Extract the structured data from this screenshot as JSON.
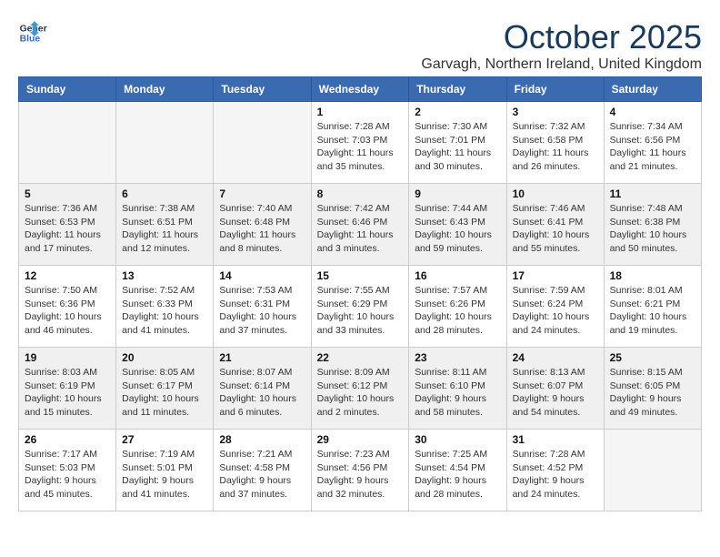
{
  "header": {
    "logo_line1": "General",
    "logo_line2": "Blue",
    "month_title": "October 2025",
    "location": "Garvagh, Northern Ireland, United Kingdom"
  },
  "days_of_week": [
    "Sunday",
    "Monday",
    "Tuesday",
    "Wednesday",
    "Thursday",
    "Friday",
    "Saturday"
  ],
  "weeks": [
    [
      {
        "day": "",
        "detail": ""
      },
      {
        "day": "",
        "detail": ""
      },
      {
        "day": "",
        "detail": ""
      },
      {
        "day": "1",
        "detail": "Sunrise: 7:28 AM\nSunset: 7:03 PM\nDaylight: 11 hours\nand 35 minutes."
      },
      {
        "day": "2",
        "detail": "Sunrise: 7:30 AM\nSunset: 7:01 PM\nDaylight: 11 hours\nand 30 minutes."
      },
      {
        "day": "3",
        "detail": "Sunrise: 7:32 AM\nSunset: 6:58 PM\nDaylight: 11 hours\nand 26 minutes."
      },
      {
        "day": "4",
        "detail": "Sunrise: 7:34 AM\nSunset: 6:56 PM\nDaylight: 11 hours\nand 21 minutes."
      }
    ],
    [
      {
        "day": "5",
        "detail": "Sunrise: 7:36 AM\nSunset: 6:53 PM\nDaylight: 11 hours\nand 17 minutes."
      },
      {
        "day": "6",
        "detail": "Sunrise: 7:38 AM\nSunset: 6:51 PM\nDaylight: 11 hours\nand 12 minutes."
      },
      {
        "day": "7",
        "detail": "Sunrise: 7:40 AM\nSunset: 6:48 PM\nDaylight: 11 hours\nand 8 minutes."
      },
      {
        "day": "8",
        "detail": "Sunrise: 7:42 AM\nSunset: 6:46 PM\nDaylight: 11 hours\nand 3 minutes."
      },
      {
        "day": "9",
        "detail": "Sunrise: 7:44 AM\nSunset: 6:43 PM\nDaylight: 10 hours\nand 59 minutes."
      },
      {
        "day": "10",
        "detail": "Sunrise: 7:46 AM\nSunset: 6:41 PM\nDaylight: 10 hours\nand 55 minutes."
      },
      {
        "day": "11",
        "detail": "Sunrise: 7:48 AM\nSunset: 6:38 PM\nDaylight: 10 hours\nand 50 minutes."
      }
    ],
    [
      {
        "day": "12",
        "detail": "Sunrise: 7:50 AM\nSunset: 6:36 PM\nDaylight: 10 hours\nand 46 minutes."
      },
      {
        "day": "13",
        "detail": "Sunrise: 7:52 AM\nSunset: 6:33 PM\nDaylight: 10 hours\nand 41 minutes."
      },
      {
        "day": "14",
        "detail": "Sunrise: 7:53 AM\nSunset: 6:31 PM\nDaylight: 10 hours\nand 37 minutes."
      },
      {
        "day": "15",
        "detail": "Sunrise: 7:55 AM\nSunset: 6:29 PM\nDaylight: 10 hours\nand 33 minutes."
      },
      {
        "day": "16",
        "detail": "Sunrise: 7:57 AM\nSunset: 6:26 PM\nDaylight: 10 hours\nand 28 minutes."
      },
      {
        "day": "17",
        "detail": "Sunrise: 7:59 AM\nSunset: 6:24 PM\nDaylight: 10 hours\nand 24 minutes."
      },
      {
        "day": "18",
        "detail": "Sunrise: 8:01 AM\nSunset: 6:21 PM\nDaylight: 10 hours\nand 19 minutes."
      }
    ],
    [
      {
        "day": "19",
        "detail": "Sunrise: 8:03 AM\nSunset: 6:19 PM\nDaylight: 10 hours\nand 15 minutes."
      },
      {
        "day": "20",
        "detail": "Sunrise: 8:05 AM\nSunset: 6:17 PM\nDaylight: 10 hours\nand 11 minutes."
      },
      {
        "day": "21",
        "detail": "Sunrise: 8:07 AM\nSunset: 6:14 PM\nDaylight: 10 hours\nand 6 minutes."
      },
      {
        "day": "22",
        "detail": "Sunrise: 8:09 AM\nSunset: 6:12 PM\nDaylight: 10 hours\nand 2 minutes."
      },
      {
        "day": "23",
        "detail": "Sunrise: 8:11 AM\nSunset: 6:10 PM\nDaylight: 9 hours\nand 58 minutes."
      },
      {
        "day": "24",
        "detail": "Sunrise: 8:13 AM\nSunset: 6:07 PM\nDaylight: 9 hours\nand 54 minutes."
      },
      {
        "day": "25",
        "detail": "Sunrise: 8:15 AM\nSunset: 6:05 PM\nDaylight: 9 hours\nand 49 minutes."
      }
    ],
    [
      {
        "day": "26",
        "detail": "Sunrise: 7:17 AM\nSunset: 5:03 PM\nDaylight: 9 hours\nand 45 minutes."
      },
      {
        "day": "27",
        "detail": "Sunrise: 7:19 AM\nSunset: 5:01 PM\nDaylight: 9 hours\nand 41 minutes."
      },
      {
        "day": "28",
        "detail": "Sunrise: 7:21 AM\nSunset: 4:58 PM\nDaylight: 9 hours\nand 37 minutes."
      },
      {
        "day": "29",
        "detail": "Sunrise: 7:23 AM\nSunset: 4:56 PM\nDaylight: 9 hours\nand 32 minutes."
      },
      {
        "day": "30",
        "detail": "Sunrise: 7:25 AM\nSunset: 4:54 PM\nDaylight: 9 hours\nand 28 minutes."
      },
      {
        "day": "31",
        "detail": "Sunrise: 7:28 AM\nSunset: 4:52 PM\nDaylight: 9 hours\nand 24 minutes."
      },
      {
        "day": "",
        "detail": ""
      }
    ]
  ]
}
